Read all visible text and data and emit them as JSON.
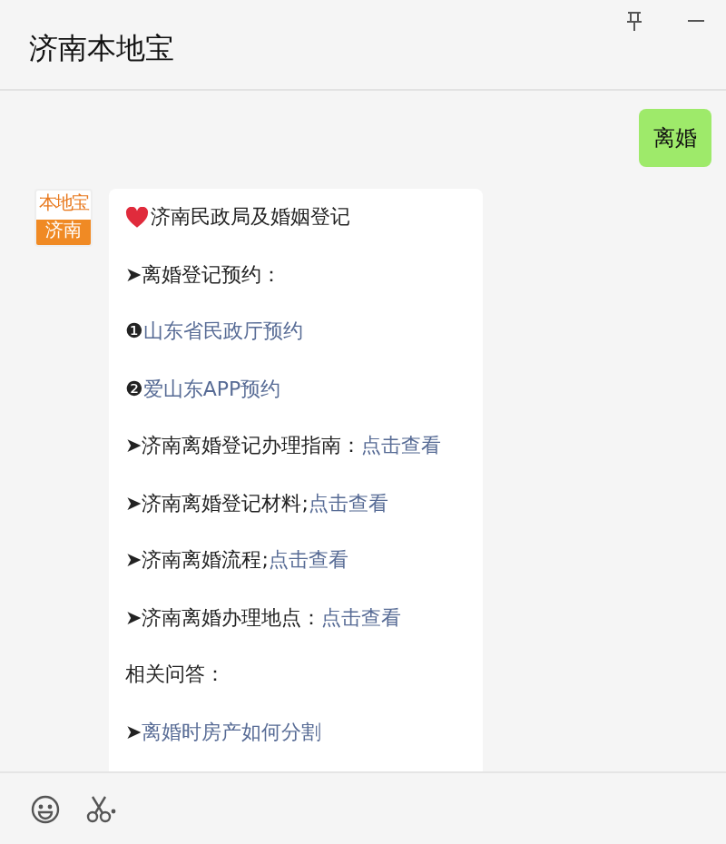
{
  "window": {
    "title": "济南本地宝"
  },
  "messages": [
    {
      "kind": "user",
      "text": "离婚"
    },
    {
      "kind": "bot",
      "avatar": {
        "brand": "本地宝",
        "city": "济南"
      },
      "lines": [
        {
          "heart": true,
          "parts": [
            {
              "text": "济南民政局及婚姻登记",
              "link": false
            }
          ]
        },
        {
          "heart": false,
          "parts": [
            {
              "text": "➤离婚登记预约：",
              "link": false
            }
          ]
        },
        {
          "heart": false,
          "parts": [
            {
              "text": "❶",
              "link": false
            },
            {
              "text": "山东省民政厅预约",
              "link": true
            }
          ]
        },
        {
          "heart": false,
          "parts": [
            {
              "text": "❷",
              "link": false
            },
            {
              "text": "爱山东APP预约",
              "link": true
            }
          ]
        },
        {
          "heart": false,
          "parts": [
            {
              "text": "➤济南离婚登记办理指南：",
              "link": false
            },
            {
              "text": "点击查看",
              "link": true
            }
          ]
        },
        {
          "heart": false,
          "parts": [
            {
              "text": "➤济南离婚登记材料;",
              "link": false
            },
            {
              "text": "点击查看",
              "link": true
            }
          ]
        },
        {
          "heart": false,
          "parts": [
            {
              "text": "➤济南离婚流程;",
              "link": false
            },
            {
              "text": "点击查看",
              "link": true
            }
          ]
        },
        {
          "heart": false,
          "parts": [
            {
              "text": "➤济南离婚办理地点：",
              "link": false
            },
            {
              "text": "点击查看",
              "link": true
            }
          ]
        },
        {
          "heart": false,
          "parts": [
            {
              "text": "相关问答：",
              "link": false
            }
          ]
        },
        {
          "heart": false,
          "parts": [
            {
              "text": "➤",
              "link": false
            },
            {
              "text": "离婚时房产如何分割",
              "link": true
            }
          ]
        }
      ]
    }
  ]
}
